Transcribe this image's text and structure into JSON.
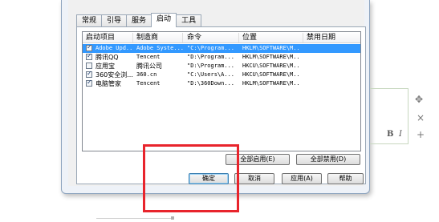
{
  "tabs": [
    "常规",
    "引导",
    "服务",
    "启动",
    "工具"
  ],
  "active_tab": "启动",
  "columns": [
    "启动项目",
    "制造商",
    "命令",
    "位置",
    "禁用日期"
  ],
  "rows": [
    {
      "item": "Adobe Upd...",
      "maker": "Adobe Syste...",
      "command": "\"C:\\Program...",
      "location": "HKLM\\SOFTWARE\\M...",
      "checked": true,
      "selected": true
    },
    {
      "item": "腾讯QQ",
      "maker": "Tencent",
      "command": "\"D:\\Program...",
      "location": "HKLM\\SOFTWARE\\M...",
      "checked": true,
      "selected": false
    },
    {
      "item": "应用宝",
      "maker": "腾讯公司",
      "command": "\"D:\\Program...",
      "location": "HKCU\\SOFTWARE\\M...",
      "checked": false,
      "selected": false
    },
    {
      "item": "360安全浏...",
      "maker": "360.cn",
      "command": "\"C:\\Users\\A...",
      "location": "HKCU\\SOFTWARE\\M...",
      "checked": true,
      "selected": false
    },
    {
      "item": "电脑管家",
      "maker": "Tencent",
      "command": "\"D:\\360Down...",
      "location": "HKLM\\SOFTWARE\\M...",
      "checked": true,
      "selected": false
    }
  ],
  "buttons": {
    "enable_all": "全部启用(E)",
    "disable_all": "全部禁用(D)",
    "ok": "确定",
    "cancel": "取消",
    "apply": "应用(A)",
    "help": "帮助"
  },
  "editor": {
    "bold": "B",
    "italic": "I",
    "move_icon": "✥",
    "close_icon": "×",
    "add_icon": "+"
  },
  "colors": {
    "selection": "#3399ff",
    "highlight_box": "#e8242c"
  }
}
